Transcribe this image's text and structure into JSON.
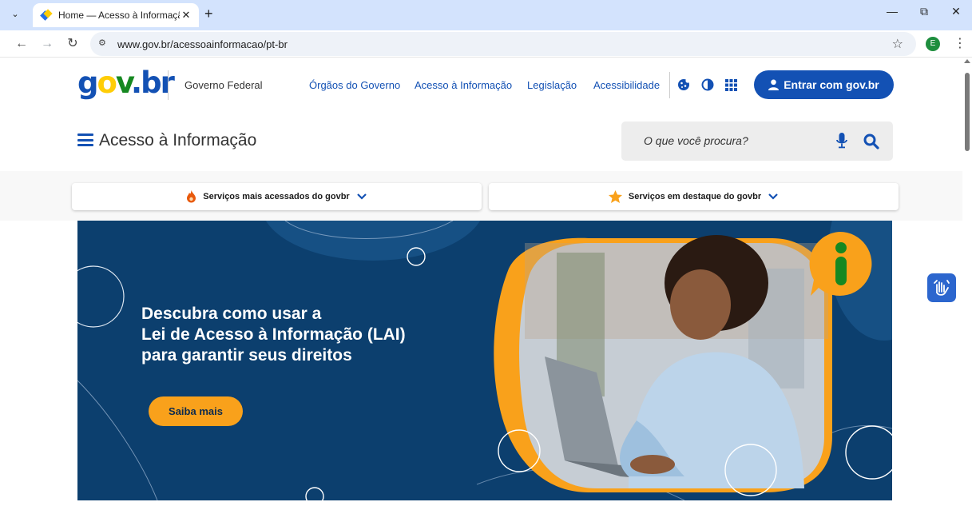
{
  "browser": {
    "tab_title": "Home — Acesso à Informação",
    "url": "www.gov.br/acessoainformacao/pt-br",
    "profile_initial": "E"
  },
  "header": {
    "logo": {
      "g": "g",
      "o": "o",
      "v": "v",
      "dot": ".",
      "b": "b",
      "r": "r"
    },
    "org_label": "Governo Federal",
    "links": [
      "Órgãos do Governo",
      "Acesso à Informação",
      "Legislação",
      "Acessibilidade"
    ],
    "login_label": "Entrar com gov.br"
  },
  "site": {
    "title": "Acesso à Informação",
    "search_placeholder": "O que você procura?"
  },
  "services": {
    "most_accessed": "Serviços mais acessados do govbr",
    "featured": "Serviços em destaque do govbr"
  },
  "hero": {
    "line1": "Descubra como usar a",
    "line2": "Lei de Acesso à Informação (LAI)",
    "line3": "para garantir seus direitos",
    "button": "Saiba mais"
  },
  "colors": {
    "brand_blue": "#1351b4",
    "hero_navy": "#0c3f6e",
    "accent_orange": "#f9a11b",
    "info_green": "#168821"
  }
}
